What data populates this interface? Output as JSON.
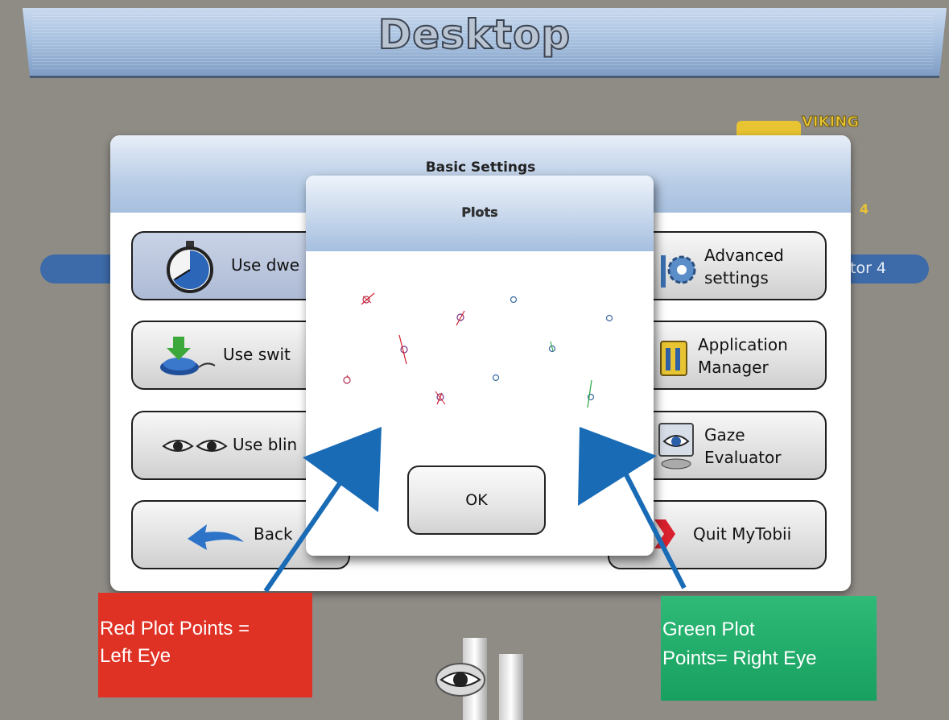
{
  "desktop": {
    "title": "Desktop"
  },
  "background": {
    "pill_text": "tor 4",
    "logo_text": "VIKING",
    "side_text": "4"
  },
  "basic_settings": {
    "title": "Basic Settings",
    "left_buttons": [
      {
        "label": "Use dwe",
        "icon": "stopwatch-icon"
      },
      {
        "label": "Use swit",
        "icon": "switch-download-icon"
      },
      {
        "label": "Use blin",
        "icon": "eyes-icon"
      },
      {
        "label": "Back",
        "icon": "back-arrow-icon"
      }
    ],
    "right_buttons": [
      {
        "label": "Advanced\nsettings",
        "icon": "tools-gear-icon"
      },
      {
        "label": "Application\nManager",
        "icon": "application-manager-icon"
      },
      {
        "label": "Gaze\nEvaluator",
        "icon": "monitor-eye-icon"
      },
      {
        "label": "Quit MyTobii",
        "icon": "quit-x-icon"
      }
    ]
  },
  "plots_dialog": {
    "title": "Plots",
    "ok_label": "OK"
  },
  "annotations": {
    "left_note": "Red Plot Points =\nLeft Eye",
    "right_note": "Green Plot\nPoints= Right Eye"
  },
  "colors": {
    "left_eye": "#d0202e",
    "right_eye": "#2aa640",
    "arrow": "#1a6bb5"
  }
}
